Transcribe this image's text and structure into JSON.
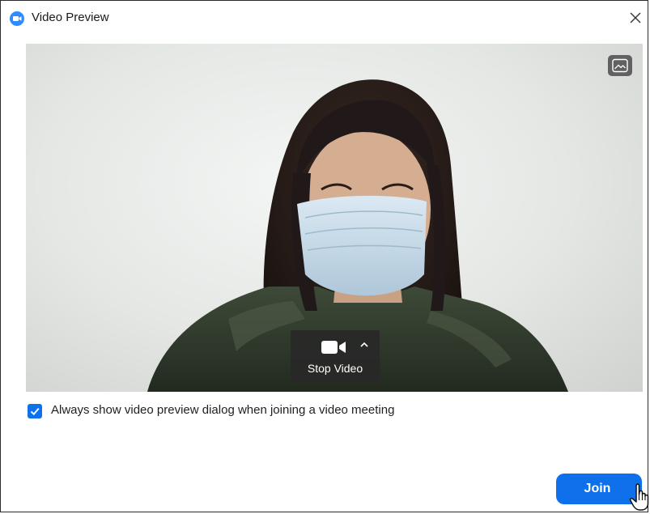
{
  "window": {
    "title": "Video Preview",
    "app_icon": "zoom-logo-icon",
    "close_icon": "close-icon"
  },
  "video": {
    "feed": "camera-preview",
    "background_toggle_icon": "image-icon",
    "control": {
      "icon": "video-camera-icon",
      "caret_icon": "chevron-up-icon",
      "label": "Stop Video"
    }
  },
  "options": {
    "always_show_preview": {
      "label": "Always show video preview dialog when joining a video meeting",
      "checked": true
    }
  },
  "actions": {
    "join_label": "Join"
  },
  "colors": {
    "accent": "#0e71eb",
    "zoom_blue": "#2d8cff",
    "control_bg": "#282828"
  }
}
